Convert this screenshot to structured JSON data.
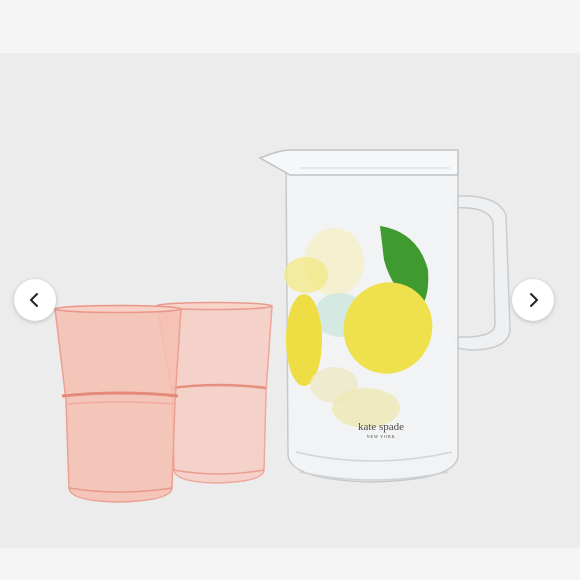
{
  "gallery": {
    "prev_icon": "chevron-left-icon",
    "next_icon": "chevron-right-icon"
  },
  "product": {
    "brand_name": "kate spade",
    "brand_subtitle": "NEW YORK"
  },
  "colors": {
    "background": "#ececec",
    "glass_tint": "#f6b5a8",
    "lemon_yellow": "#efe04d",
    "leaf_green": "#3f9a2f"
  }
}
